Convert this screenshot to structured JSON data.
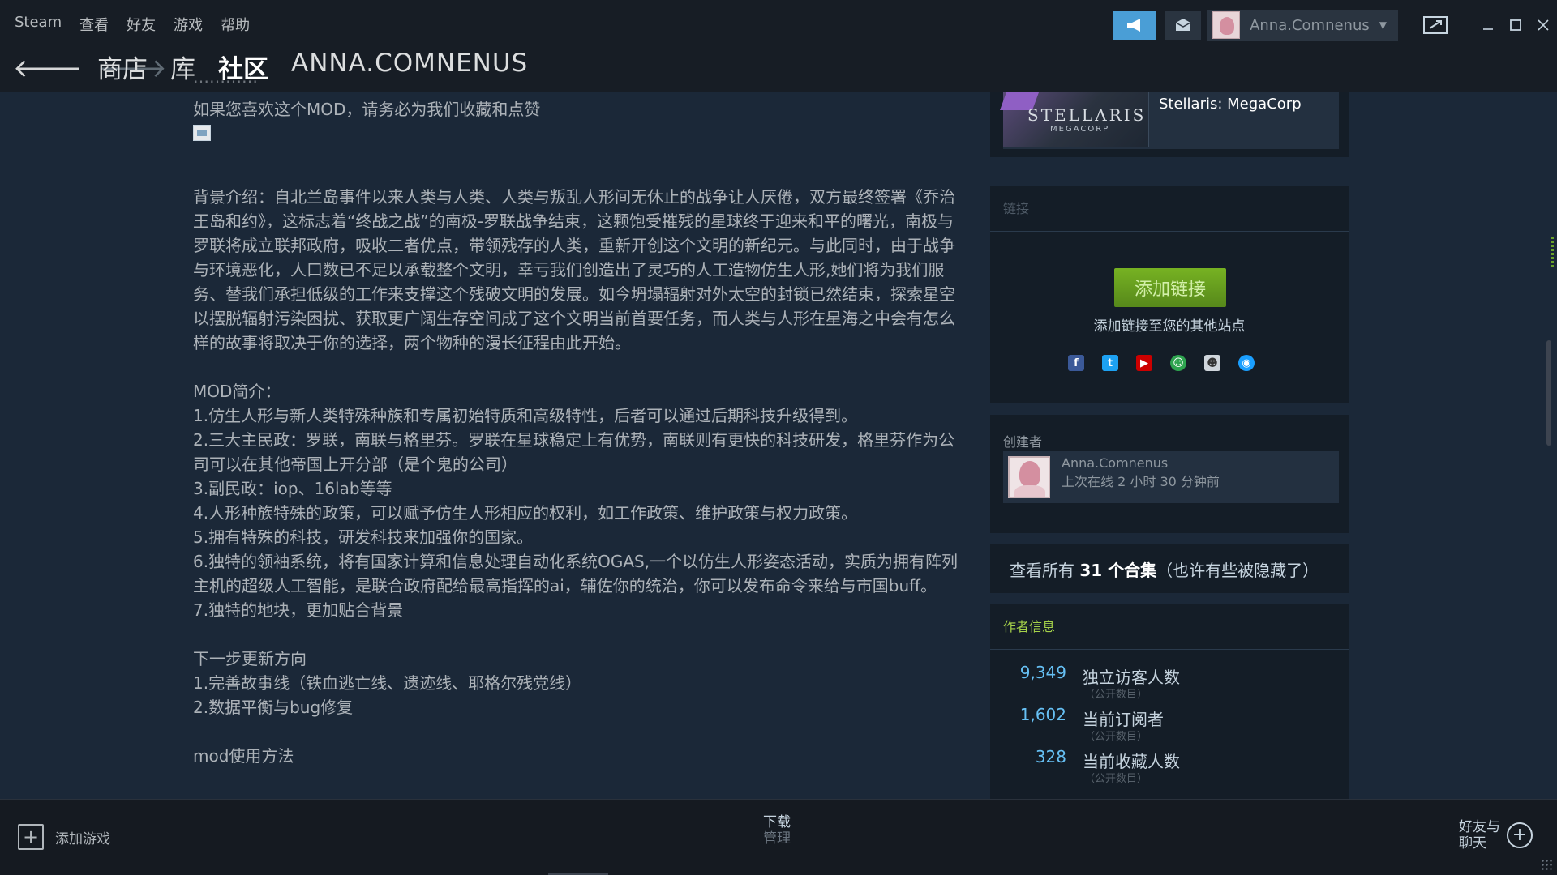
{
  "menu": {
    "items": [
      "Steam",
      "查看",
      "好友",
      "游戏",
      "帮助"
    ]
  },
  "account": {
    "name": "Anna.Comnenus"
  },
  "nav": {
    "store": "商店",
    "library": "库",
    "community": "社区",
    "username": "ANNA.COMNENUS"
  },
  "description": {
    "cut_line": "…………",
    "lead": "如果您喜欢这个MOD，请务必为我们收藏和点赞",
    "background": "背景介绍：自北兰岛事件以来人类与人类、人类与叛乱人形间无休止的战争让人厌倦，双方最终签署《乔治王岛和约》，这标志着“终战之战”的南极-罗联战争结束，这颗饱受摧残的星球终于迎来和平的曙光，南极与罗联将成立联邦政府，吸收二者优点，带领残存的人类，重新开创这个文明的新纪元。与此同时，由于战争与环境恶化，人口数已不足以承载整个文明，幸亏我们创造出了灵巧的人工造物仿生人形,她们将为我们服务、替我们承担低级的工作来支撑这个残破文明的发展。如今坍塌辐射对外太空的封锁已然结束，探索星空以摆脱辐射污染困扰、获取更广阔生存空间成了这个文明当前首要任务，而人类与人形在星海之中会有怎么样的故事将取决于你的选择，两个物种的漫长征程由此开始。",
    "mod_intro_title": "MOD简介：",
    "mod_items": [
      "1.仿生人形与新人类特殊种族和专属初始特质和高级特性，后者可以通过后期科技升级得到。",
      "2.三大主民政：罗联，南联与格里芬。罗联在星球稳定上有优势，南联则有更快的科技研发，格里芬作为公司可以在其他帝国上开分部（是个鬼的公司）",
      "3.副民政：iop、16lab等等",
      "4.人形种族特殊的政策，可以赋予仿生人形相应的权利，如工作政策、维护政策与权力政策。",
      "5.拥有特殊的科技，研发科技来加强你的国家。",
      "6.独特的领袖系统，将有国家计算和信息处理自动化系统OGAS,一个以仿生人形姿态活动，实质为拥有阵列主机的超级人工智能，是联合政府配给最高指挥的ai，辅佐你的统治，你可以发布命令来给与市国buff。",
      "7.独特的地块，更加贴合背景"
    ],
    "next_title": "下一步更新方向",
    "next_items": [
      "1.完善故事线（铁血逃亡线、遗迹线、耶格尔残党线）",
      "2.数据平衡与bug修复"
    ],
    "usage_title": "mod使用方法"
  },
  "dlc": {
    "title": "Stellaris: MegaCorp",
    "logo": "STELLARIS",
    "logo_sub": "MEGACORP"
  },
  "links": {
    "title": "链接",
    "add_button": "添加链接",
    "add_desc": "添加链接至您的其他站点",
    "socials": [
      "facebook-icon",
      "twitter-icon",
      "youtube-icon",
      "smile-icon",
      "reddit-icon",
      "steam-icon"
    ]
  },
  "creator": {
    "label": "创建者",
    "name": "Anna.Comnenus",
    "status": "上次在线 2 小时 30 分钟前"
  },
  "collections": {
    "prefix": "查看所有 ",
    "count": "31 个合集",
    "suffix": "（也许有些被隐藏了）"
  },
  "author_info": {
    "title": "作者信息",
    "stats": [
      {
        "value": "9,349",
        "label": "独立访客人数",
        "sub": "（公开数目）"
      },
      {
        "value": "1,602",
        "label": "当前订阅者",
        "sub": "（公开数目）"
      },
      {
        "value": "328",
        "label": "当前收藏人数",
        "sub": "（公开数目）"
      }
    ]
  },
  "bottom": {
    "add_game": "添加游戏",
    "download": "下载",
    "manage": "管理",
    "friends_line1": "好友与",
    "friends_line2": "聊天"
  },
  "colors": {
    "background": "#1b2838",
    "accent_blue": "#66c0f4",
    "accent_green": "#75b022"
  }
}
